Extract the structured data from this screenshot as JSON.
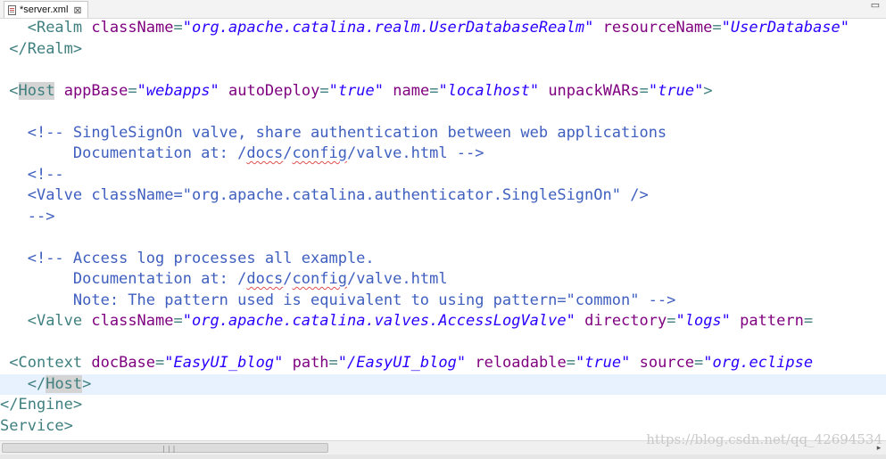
{
  "tab": {
    "title": "*server.xml",
    "close": "⊠"
  },
  "window": {
    "restore": "▭"
  },
  "watermark": "https://blog.csdn.net/qq_42694534",
  "lines": [
    {
      "segments": [
        {
          "t": "   "
        },
        {
          "t": "<Realm ",
          "c": "tagc"
        },
        {
          "t": "className",
          "c": "attr"
        },
        {
          "t": "=",
          "c": "tagc"
        },
        {
          "t": "\"org.apache.catalina.realm.UserDatabaseRealm\"",
          "c": "val"
        },
        {
          "t": " "
        },
        {
          "t": "resourceName",
          "c": "attr"
        },
        {
          "t": "=",
          "c": "tagc"
        },
        {
          "t": "\"UserDatabase\"",
          "c": "val"
        }
      ]
    },
    {
      "segments": [
        {
          "t": " "
        },
        {
          "t": "</Realm>",
          "c": "tagc"
        }
      ]
    },
    {
      "segments": []
    },
    {
      "segments": [
        {
          "t": " "
        },
        {
          "t": "<",
          "c": "tagc"
        },
        {
          "t": "Host",
          "c": "tagc tagmatch"
        },
        {
          "t": " "
        },
        {
          "t": "appBase",
          "c": "attr"
        },
        {
          "t": "=",
          "c": "tagc"
        },
        {
          "t": "\"webapps\"",
          "c": "val"
        },
        {
          "t": " "
        },
        {
          "t": "autoDeploy",
          "c": "attr"
        },
        {
          "t": "=",
          "c": "tagc"
        },
        {
          "t": "\"true\"",
          "c": "val"
        },
        {
          "t": " "
        },
        {
          "t": "name",
          "c": "attr"
        },
        {
          "t": "=",
          "c": "tagc"
        },
        {
          "t": "\"localhost\"",
          "c": "val"
        },
        {
          "t": " "
        },
        {
          "t": "unpackWARs",
          "c": "attr"
        },
        {
          "t": "=",
          "c": "tagc"
        },
        {
          "t": "\"true\"",
          "c": "val"
        },
        {
          "t": ">",
          "c": "tagc"
        }
      ]
    },
    {
      "segments": []
    },
    {
      "segments": [
        {
          "t": "   "
        },
        {
          "t": "<!-- SingleSignOn valve, share authentication between web applications",
          "c": "cmt"
        }
      ]
    },
    {
      "segments": [
        {
          "t": "        Documentation at: /",
          "c": "cmt"
        },
        {
          "t": "docs",
          "c": "cmt squig"
        },
        {
          "t": "/",
          "c": "cmt"
        },
        {
          "t": "config",
          "c": "cmt squig"
        },
        {
          "t": "/valve.html -->",
          "c": "cmt"
        }
      ]
    },
    {
      "segments": [
        {
          "t": "   "
        },
        {
          "t": "<!--",
          "c": "cmt"
        }
      ]
    },
    {
      "segments": [
        {
          "t": "   "
        },
        {
          "t": "<Valve className=\"org.apache.catalina.authenticator.SingleSignOn\" />",
          "c": "cmt"
        }
      ]
    },
    {
      "segments": [
        {
          "t": "   "
        },
        {
          "t": "-->",
          "c": "cmt"
        }
      ]
    },
    {
      "segments": []
    },
    {
      "segments": [
        {
          "t": "   "
        },
        {
          "t": "<!-- Access log processes all example.",
          "c": "cmt"
        }
      ]
    },
    {
      "segments": [
        {
          "t": "        Documentation at: /",
          "c": "cmt"
        },
        {
          "t": "docs",
          "c": "cmt squig"
        },
        {
          "t": "/",
          "c": "cmt"
        },
        {
          "t": "config",
          "c": "cmt squig"
        },
        {
          "t": "/valve.html",
          "c": "cmt"
        }
      ]
    },
    {
      "segments": [
        {
          "t": "        Note: The pattern used is equivalent to using pattern=\"common\" -->",
          "c": "cmt"
        }
      ]
    },
    {
      "segments": [
        {
          "t": "   "
        },
        {
          "t": "<Valve ",
          "c": "tagc"
        },
        {
          "t": "className",
          "c": "attr"
        },
        {
          "t": "=",
          "c": "tagc"
        },
        {
          "t": "\"org.apache.catalina.valves.AccessLogValve\"",
          "c": "val"
        },
        {
          "t": " "
        },
        {
          "t": "directory",
          "c": "attr"
        },
        {
          "t": "=",
          "c": "tagc"
        },
        {
          "t": "\"logs\"",
          "c": "val"
        },
        {
          "t": " "
        },
        {
          "t": "pattern",
          "c": "attr"
        },
        {
          "t": "=",
          "c": "tagc"
        }
      ]
    },
    {
      "segments": []
    },
    {
      "segments": [
        {
          "t": " "
        },
        {
          "t": "<Context ",
          "c": "tagc"
        },
        {
          "t": "docBase",
          "c": "attr"
        },
        {
          "t": "=",
          "c": "tagc"
        },
        {
          "t": "\"EasyUI_blog\"",
          "c": "val"
        },
        {
          "t": " "
        },
        {
          "t": "path",
          "c": "attr"
        },
        {
          "t": "=",
          "c": "tagc"
        },
        {
          "t": "\"/EasyUI_blog\"",
          "c": "val"
        },
        {
          "t": " "
        },
        {
          "t": "reloadable",
          "c": "attr"
        },
        {
          "t": "=",
          "c": "tagc"
        },
        {
          "t": "\"true\"",
          "c": "val"
        },
        {
          "t": " "
        },
        {
          "t": "source",
          "c": "attr"
        },
        {
          "t": "=",
          "c": "tagc"
        },
        {
          "t": "\"org.eclipse",
          "c": "val"
        }
      ]
    },
    {
      "segments": [
        {
          "t": "   "
        },
        {
          "t": "</",
          "c": "tagc"
        },
        {
          "t": "Host",
          "c": "tagc tagmatch"
        },
        {
          "t": ">",
          "c": "tagc"
        }
      ],
      "highlight": true
    },
    {
      "segments": [
        {
          "t": "</Engine>",
          "c": "tagc"
        }
      ]
    },
    {
      "segments": [
        {
          "t": "Service>",
          "c": "tagc"
        }
      ]
    }
  ],
  "scrollbar": {
    "grip": "|||",
    "right_arrow": "▸"
  }
}
